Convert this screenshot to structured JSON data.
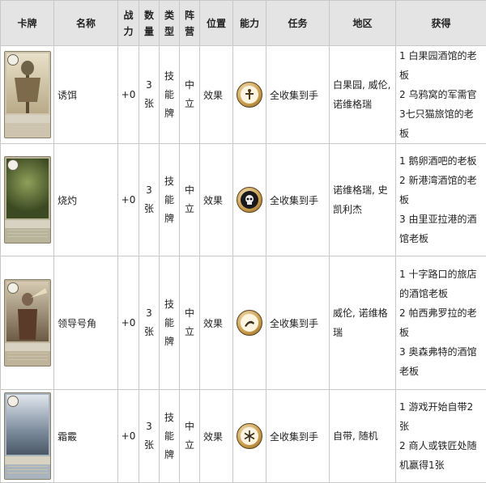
{
  "headers": {
    "card": "卡牌",
    "name": "名称",
    "power": "战力",
    "count": "数量",
    "type": "类型",
    "faction": "阵营",
    "position": "位置",
    "ability": "能力",
    "task": "任务",
    "region": "地区",
    "obtain": "获得"
  },
  "rows": [
    {
      "card_icon": "scarecrow-card-art",
      "name": "诱饵",
      "power": "+0",
      "count": "3张",
      "type": "技能牌",
      "faction": "中立",
      "position": "效果",
      "ability_icon": "decoy-ability-icon",
      "task": "全收集到手",
      "region": "白果园, 威伦, 诺维格瑞",
      "obtain": [
        "1 白果园酒馆的老板",
        "2 乌鸦窝的军需官",
        "3七只猫旅馆的老板"
      ]
    },
    {
      "card_icon": "scorch-card-art",
      "name": "烧灼",
      "power": "+0",
      "count": "3张",
      "type": "技能牌",
      "faction": "中立",
      "position": "效果",
      "ability_icon": "skull-ability-icon",
      "task": "全收集到手",
      "region": "诺维格瑞, 史凯利杰",
      "obtain": [
        "1 鹅卵酒吧的老板",
        "2 新港湾酒馆的老板",
        "3 由里亚拉港的酒馆老板"
      ]
    },
    {
      "card_icon": "horn-card-art",
      "name": "领导号角",
      "power": "+0",
      "count": "3张",
      "type": "技能牌",
      "faction": "中立",
      "position": "效果",
      "ability_icon": "horn-ability-icon",
      "task": "全收集到手",
      "region": "威伦, 诺维格瑞",
      "obtain": [
        "1 十字路口的旅店的酒馆老板",
        "2 帕西弗罗拉的老板",
        "3 奥森弗特的酒馆老板"
      ]
    },
    {
      "card_icon": "frost-card-art",
      "name": "霜霰",
      "power": "+0",
      "count": "3张",
      "type": "技能牌",
      "faction": "中立",
      "position": "效果",
      "ability_icon": "snowflake-ability-icon",
      "task": "全收集到手",
      "region": "自带, 随机",
      "obtain": [
        "1 游戏开始自带2张",
        "2 商人或铁匠处随机赢得1张"
      ]
    }
  ]
}
